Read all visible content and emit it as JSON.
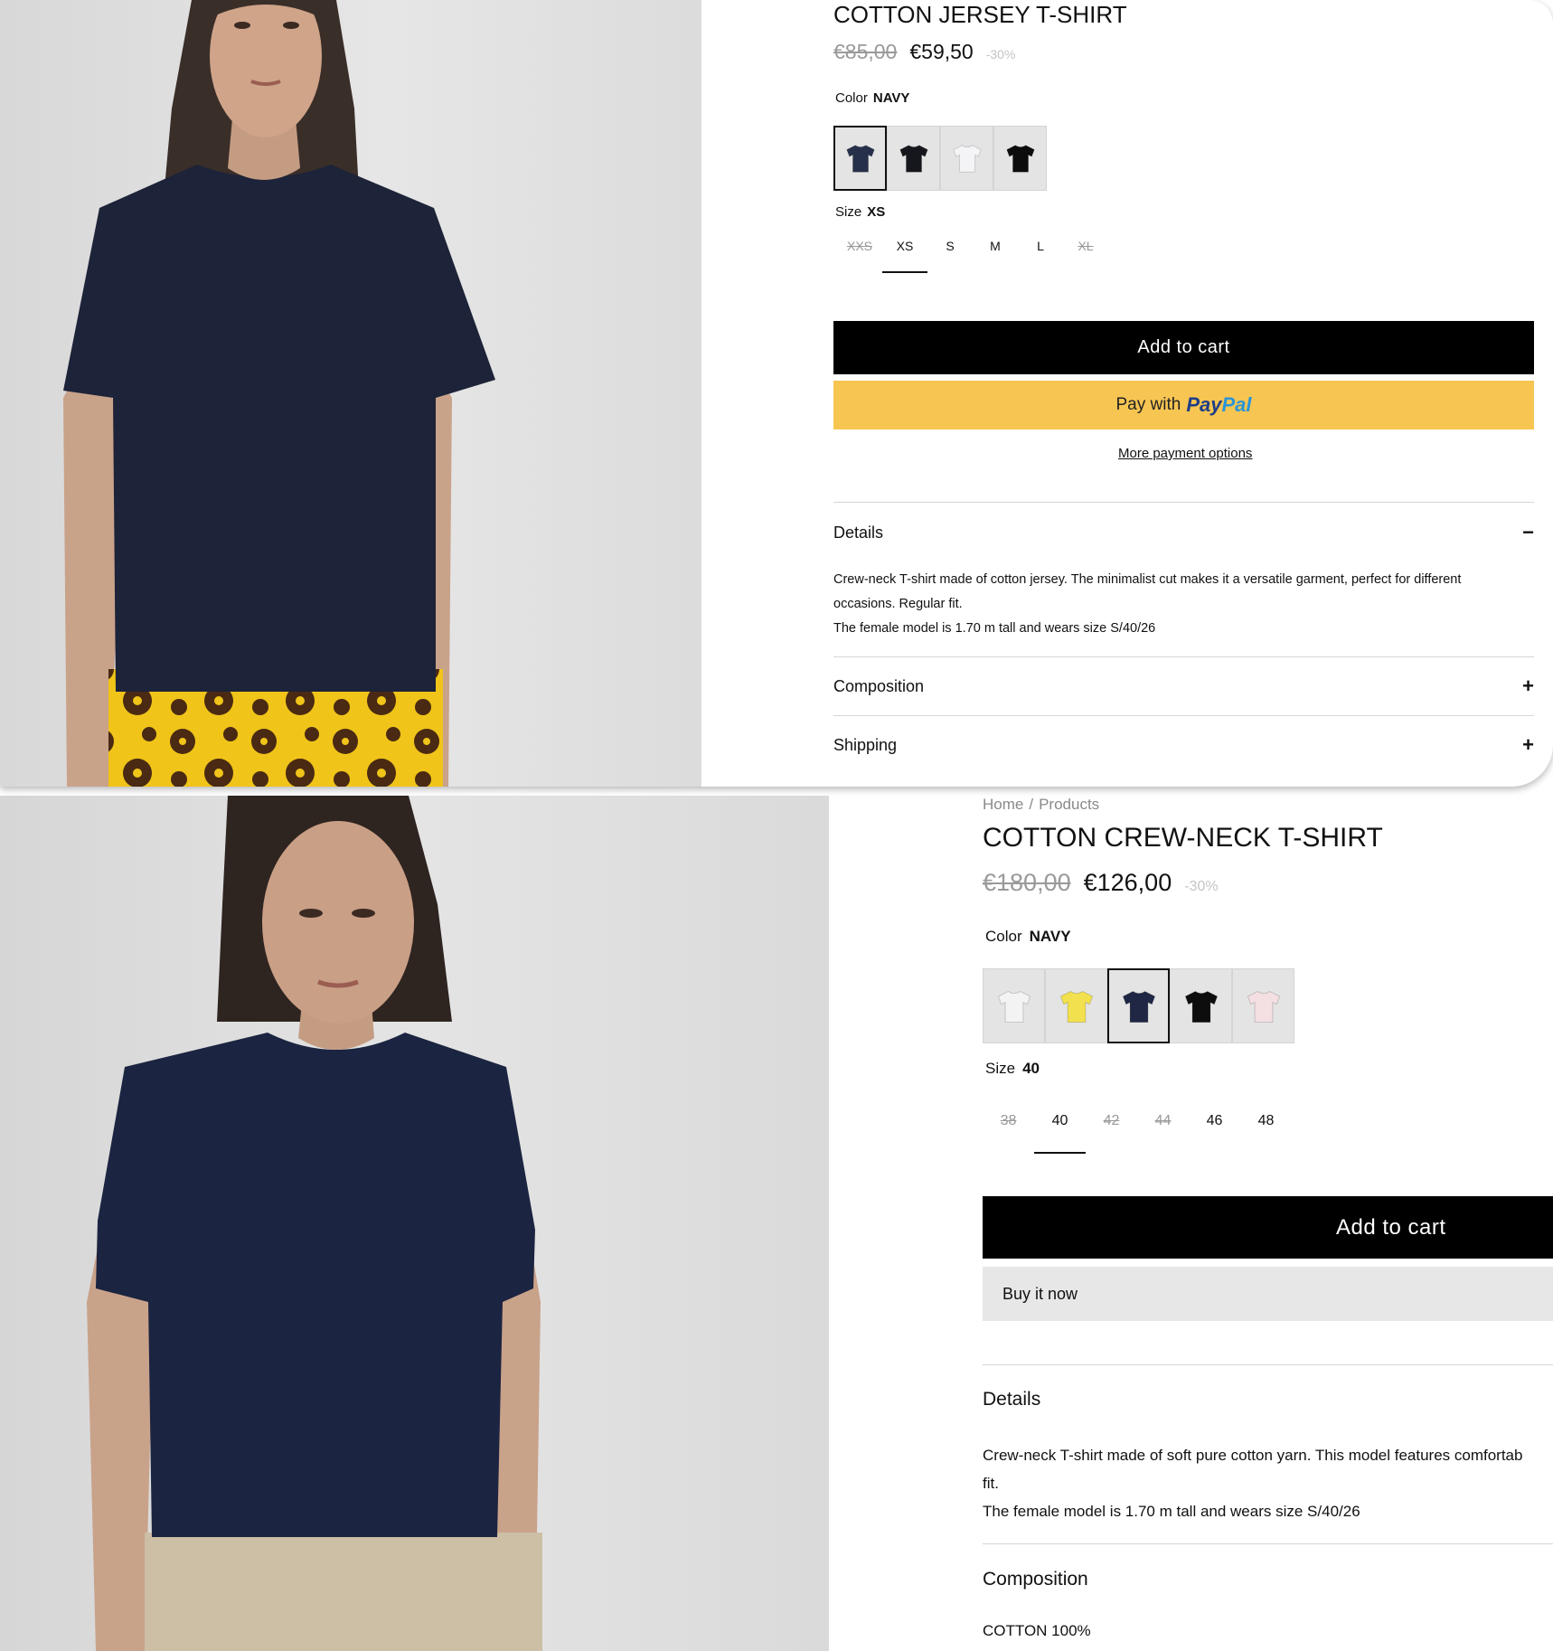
{
  "p1": {
    "title": "COTTON JERSEY T-SHIRT",
    "price_old": "€85,00",
    "price_new": "€59,50",
    "discount": "-30%",
    "color_label": "Color",
    "color_value": "NAVY",
    "swatches": [
      {
        "name": "navy",
        "color": "#27304a",
        "selected": true
      },
      {
        "name": "dark",
        "color": "#15171d",
        "selected": false
      },
      {
        "name": "white",
        "color": "#f4f4f6",
        "selected": false
      },
      {
        "name": "black",
        "color": "#0c0c0c",
        "selected": false
      }
    ],
    "size_label": "Size",
    "size_value": "XS",
    "sizes": [
      {
        "label": "XXS",
        "available": false,
        "selected": false
      },
      {
        "label": "XS",
        "available": true,
        "selected": true
      },
      {
        "label": "S",
        "available": true,
        "selected": false
      },
      {
        "label": "M",
        "available": true,
        "selected": false
      },
      {
        "label": "L",
        "available": true,
        "selected": false
      },
      {
        "label": "XL",
        "available": false,
        "selected": false
      }
    ],
    "add_to_cart": "Add to cart",
    "paypal_prefix": "Pay with",
    "paypal_brand_1": "Pay",
    "paypal_brand_2": "Pal",
    "more_payment": "More payment options",
    "details_title": "Details",
    "details_icon": "−",
    "details_lines": [
      "Crew-neck T-shirt made of cotton jersey. The minimalist cut makes it a versatile garment, perfect for different",
      "occasions. Regular fit.",
      "The female model is 1.70 m tall and wears size S/40/26"
    ],
    "composition_title": "Composition",
    "composition_icon": "+",
    "shipping_title": "Shipping",
    "shipping_icon": "+"
  },
  "p2": {
    "breadcrumb_home": "Home",
    "breadcrumb_sep": "/",
    "breadcrumb_products": "Products",
    "title": "COTTON CREW-NECK T-SHIRT",
    "price_old": "€180,00",
    "price_new": "€126,00",
    "discount": "-30%",
    "color_label": "Color",
    "color_value": "NAVY",
    "swatches": [
      {
        "name": "white",
        "color": "#f3f3f3",
        "selected": false
      },
      {
        "name": "yellow",
        "color": "#f2e04e",
        "selected": false
      },
      {
        "name": "navy",
        "color": "#1f2744",
        "selected": true
      },
      {
        "name": "black",
        "color": "#0d0d0d",
        "selected": false
      },
      {
        "name": "pink",
        "color": "#f4dfe3",
        "selected": false
      }
    ],
    "size_label": "Size",
    "size_value": "40",
    "sizes": [
      {
        "label": "38",
        "available": false,
        "selected": false
      },
      {
        "label": "40",
        "available": true,
        "selected": true
      },
      {
        "label": "42",
        "available": false,
        "selected": false
      },
      {
        "label": "44",
        "available": false,
        "selected": false
      },
      {
        "label": "46",
        "available": true,
        "selected": false
      },
      {
        "label": "48",
        "available": true,
        "selected": false
      }
    ],
    "add_to_cart": "Add to cart",
    "buy_now": "Buy it now",
    "details_title": "Details",
    "details_lines": [
      "Crew-neck T-shirt made of soft pure cotton yarn. This model features comfortab",
      "fit.",
      "The female model is 1.70 m tall and wears size S/40/26"
    ],
    "composition_title": "Composition",
    "composition_text": "COTTON 100%"
  }
}
